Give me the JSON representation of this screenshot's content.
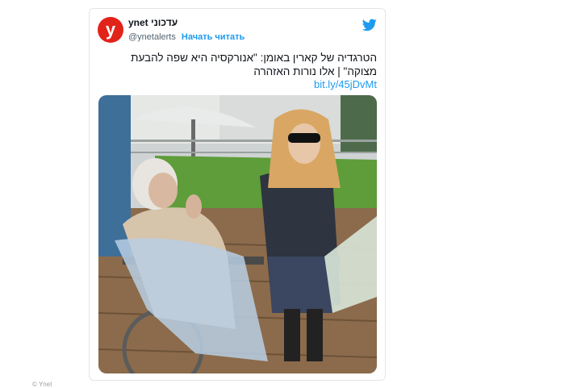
{
  "tweet": {
    "avatar_letter": "y",
    "display_name": "ynet עדכוני",
    "handle": "@ynetalerts",
    "follow_label": "Начать читать",
    "text": "הטרגדיה של קארין באומן: \"אנורקסיה היא שפה להבעת מצוקה\" | אלו נורות האזהרה",
    "link": "bit.ly/45jDvMt",
    "brand_color": "#e2231a",
    "link_color": "#1d9bf0",
    "icons": {
      "platform": "twitter-bird-icon"
    }
  },
  "footer": {
    "watermark": "© Ynet"
  }
}
